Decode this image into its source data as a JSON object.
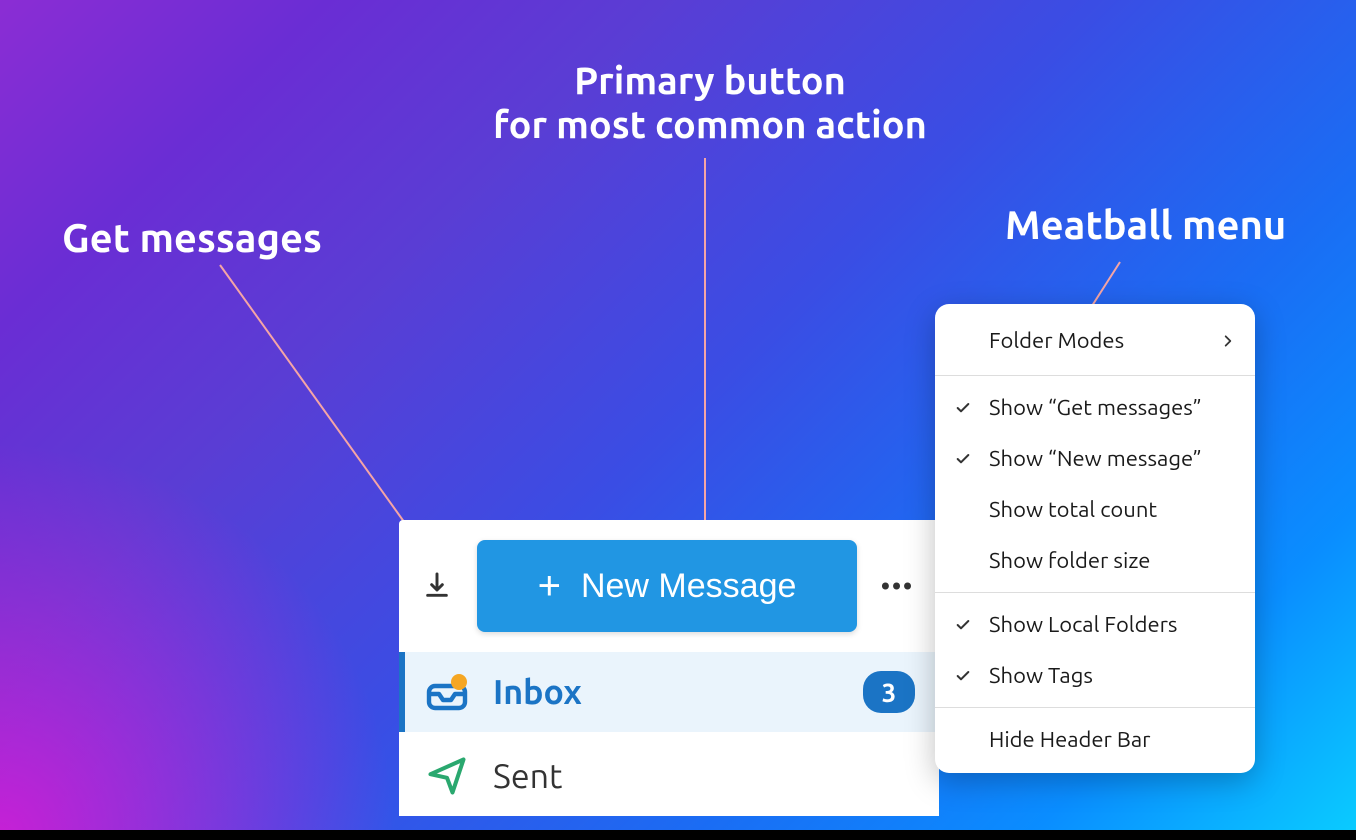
{
  "annotations": {
    "primary": "Primary button\nfor most common action",
    "get": "Get messages",
    "meatball": "Meatball menu"
  },
  "toolbar": {
    "new_message_label": "New Message"
  },
  "folders": {
    "inbox": {
      "label": "Inbox",
      "badge": "3"
    },
    "sent": {
      "label": "Sent"
    }
  },
  "menu": {
    "folder_modes": "Folder Modes",
    "show_get": "Show “Get messages”",
    "show_new": "Show “New message”",
    "show_total": "Show total count",
    "show_size": "Show folder size",
    "show_local": "Show Local Folders",
    "show_tags": "Show Tags",
    "hide_header": "Hide Header Bar"
  }
}
